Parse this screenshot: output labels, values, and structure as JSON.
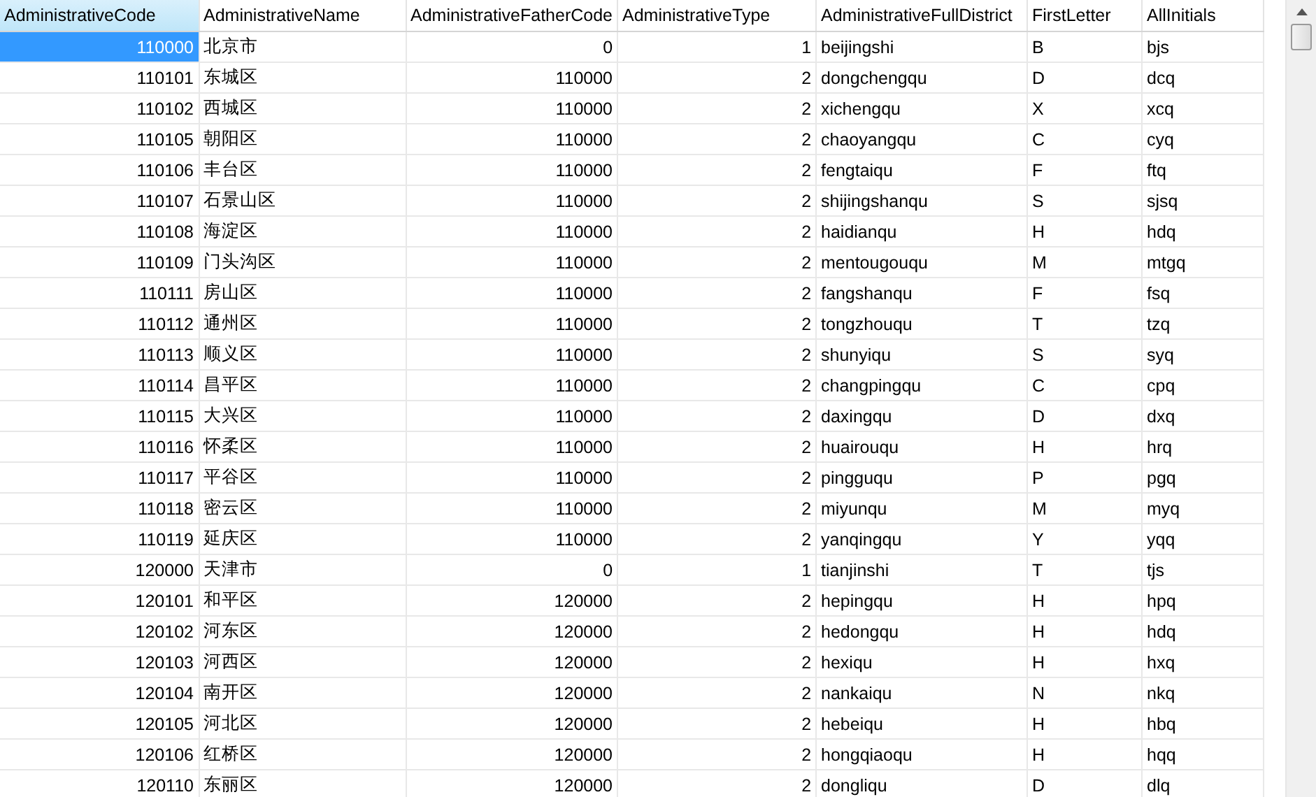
{
  "table": {
    "columns": [
      {
        "label": "AdministrativeCode",
        "kind": "number",
        "current": true
      },
      {
        "label": "AdministrativeName",
        "kind": "text",
        "current": false
      },
      {
        "label": "AdministrativeFatherCode",
        "kind": "number",
        "current": false
      },
      {
        "label": "AdministrativeType",
        "kind": "number",
        "current": false
      },
      {
        "label": "AdministrativeFullDistrict",
        "kind": "text",
        "current": false
      },
      {
        "label": "FirstLetter",
        "kind": "text",
        "current": false
      },
      {
        "label": "AllInitials",
        "kind": "text",
        "current": false
      }
    ],
    "rows": [
      {
        "selected": true,
        "cells": [
          "110000",
          "北京市",
          "0",
          "1",
          "beijingshi",
          "B",
          "bjs"
        ]
      },
      {
        "selected": false,
        "cells": [
          "110101",
          "东城区",
          "110000",
          "2",
          "dongchengqu",
          "D",
          "dcq"
        ]
      },
      {
        "selected": false,
        "cells": [
          "110102",
          "西城区",
          "110000",
          "2",
          "xichengqu",
          "X",
          "xcq"
        ]
      },
      {
        "selected": false,
        "cells": [
          "110105",
          "朝阳区",
          "110000",
          "2",
          "chaoyangqu",
          "C",
          "cyq"
        ]
      },
      {
        "selected": false,
        "cells": [
          "110106",
          "丰台区",
          "110000",
          "2",
          "fengtaiqu",
          "F",
          "ftq"
        ]
      },
      {
        "selected": false,
        "cells": [
          "110107",
          "石景山区",
          "110000",
          "2",
          "shijingshanqu",
          "S",
          "sjsq"
        ]
      },
      {
        "selected": false,
        "cells": [
          "110108",
          "海淀区",
          "110000",
          "2",
          "haidianqu",
          "H",
          "hdq"
        ]
      },
      {
        "selected": false,
        "cells": [
          "110109",
          "门头沟区",
          "110000",
          "2",
          "mentougouqu",
          "M",
          "mtgq"
        ]
      },
      {
        "selected": false,
        "cells": [
          "110111",
          "房山区",
          "110000",
          "2",
          "fangshanqu",
          "F",
          "fsq"
        ]
      },
      {
        "selected": false,
        "cells": [
          "110112",
          "通州区",
          "110000",
          "2",
          "tongzhouqu",
          "T",
          "tzq"
        ]
      },
      {
        "selected": false,
        "cells": [
          "110113",
          "顺义区",
          "110000",
          "2",
          "shunyiqu",
          "S",
          "syq"
        ]
      },
      {
        "selected": false,
        "cells": [
          "110114",
          "昌平区",
          "110000",
          "2",
          "changpingqu",
          "C",
          "cpq"
        ]
      },
      {
        "selected": false,
        "cells": [
          "110115",
          "大兴区",
          "110000",
          "2",
          "daxingqu",
          "D",
          "dxq"
        ]
      },
      {
        "selected": false,
        "cells": [
          "110116",
          "怀柔区",
          "110000",
          "2",
          "huairouqu",
          "H",
          "hrq"
        ]
      },
      {
        "selected": false,
        "cells": [
          "110117",
          "平谷区",
          "110000",
          "2",
          "pingguqu",
          "P",
          "pgq"
        ]
      },
      {
        "selected": false,
        "cells": [
          "110118",
          "密云区",
          "110000",
          "2",
          "miyunqu",
          "M",
          "myq"
        ]
      },
      {
        "selected": false,
        "cells": [
          "110119",
          "延庆区",
          "110000",
          "2",
          "yanqingqu",
          "Y",
          "yqq"
        ]
      },
      {
        "selected": false,
        "cells": [
          "120000",
          "天津市",
          "0",
          "1",
          "tianjinshi",
          "T",
          "tjs"
        ]
      },
      {
        "selected": false,
        "cells": [
          "120101",
          "和平区",
          "120000",
          "2",
          "hepingqu",
          "H",
          "hpq"
        ]
      },
      {
        "selected": false,
        "cells": [
          "120102",
          "河东区",
          "120000",
          "2",
          "hedongqu",
          "H",
          "hdq"
        ]
      },
      {
        "selected": false,
        "cells": [
          "120103",
          "河西区",
          "120000",
          "2",
          "hexiqu",
          "H",
          "hxq"
        ]
      },
      {
        "selected": false,
        "cells": [
          "120104",
          "南开区",
          "120000",
          "2",
          "nankaiqu",
          "N",
          "nkq"
        ]
      },
      {
        "selected": false,
        "cells": [
          "120105",
          "河北区",
          "120000",
          "2",
          "hebeiqu",
          "H",
          "hbq"
        ]
      },
      {
        "selected": false,
        "cells": [
          "120106",
          "红桥区",
          "120000",
          "2",
          "hongqiaoqu",
          "H",
          "hqq"
        ]
      },
      {
        "selected": false,
        "cells": [
          "120110",
          "东丽区",
          "120000",
          "2",
          "dongliqu",
          "D",
          "dlq"
        ]
      }
    ]
  }
}
